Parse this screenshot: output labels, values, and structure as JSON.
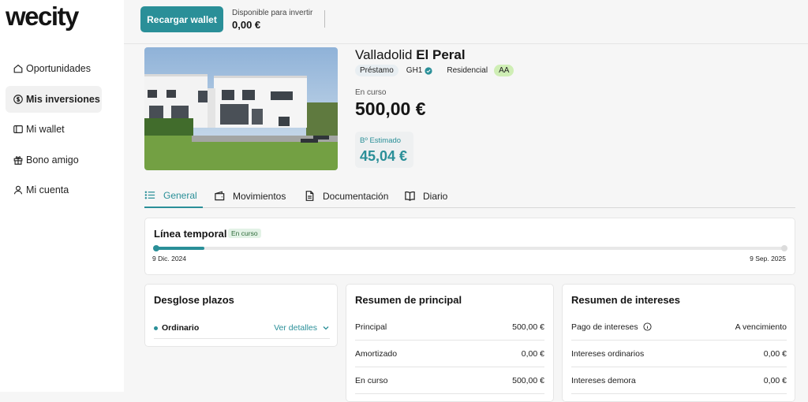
{
  "brand": {
    "logo": "wecity",
    "accent": "#2a8f98"
  },
  "sidebar": {
    "items": [
      {
        "label": "Oportunidades",
        "icon": "home-icon",
        "active": false
      },
      {
        "label": "Mis inversiones",
        "icon": "dollar-circle-icon",
        "active": true
      },
      {
        "label": "Mi wallet",
        "icon": "wallet-icon",
        "active": false
      },
      {
        "label": "Bono amigo",
        "icon": "gift-icon",
        "active": false
      },
      {
        "label": "Mi cuenta",
        "icon": "user-icon",
        "active": false
      }
    ]
  },
  "topbar": {
    "recharge_label": "Recargar wallet",
    "available_label": "Disponible para invertir",
    "available_value": "0,00 €"
  },
  "project": {
    "title_city": "Valladolid",
    "title_name": "El Peral",
    "tags": {
      "type": "Préstamo",
      "grade": "GH1",
      "segment": "Residencial",
      "rating": "AA"
    },
    "status_label": "En curso",
    "status_value": "500,00 €",
    "estimated_label": "Bº Estimado",
    "estimated_value": "45,04 €"
  },
  "tabs": [
    {
      "label": "General",
      "icon": "list-icon",
      "active": true
    },
    {
      "label": "Movimientos",
      "icon": "wallet-icon",
      "active": false
    },
    {
      "label": "Documentación",
      "icon": "document-icon",
      "active": false
    },
    {
      "label": "Diario",
      "icon": "book-icon",
      "active": false
    }
  ],
  "timeline": {
    "title": "Línea temporal",
    "badge": "En curso",
    "start_date": "9 Dic. 2024",
    "end_date": "9 Sep. 2025",
    "progress_fraction": 0.08
  },
  "breakdown": {
    "title": "Desglose plazos",
    "rows": [
      {
        "name": "Ordinario",
        "link": "Ver detalles"
      }
    ]
  },
  "principal": {
    "title": "Resumen de principal",
    "rows": [
      {
        "label": "Principal",
        "value": "500,00 €"
      },
      {
        "label": "Amortizado",
        "value": "0,00 €"
      },
      {
        "label": "En curso",
        "value": "500,00 €"
      }
    ]
  },
  "interests": {
    "title": "Resumen de intereses",
    "rows": [
      {
        "label": "Pago de intereses",
        "value": "A vencimiento"
      },
      {
        "label": "Intereses ordinarios",
        "value": "0,00 €"
      },
      {
        "label": "Intereses demora",
        "value": "0,00 €"
      }
    ]
  }
}
